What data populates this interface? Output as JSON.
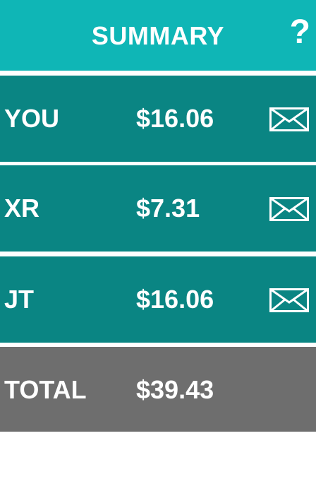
{
  "header": {
    "title": "SUMMARY",
    "help_label": "?"
  },
  "rows": [
    {
      "name": "YOU",
      "amount": "$16.06",
      "icon": "envelope-icon"
    },
    {
      "name": "XR",
      "amount": "$7.31",
      "icon": "envelope-icon"
    },
    {
      "name": "JT",
      "amount": "$16.06",
      "icon": "envelope-icon"
    }
  ],
  "total": {
    "label": "TOTAL",
    "amount": "$39.43"
  },
  "colors": {
    "header_bg": "#0fb6b6",
    "row_bg": "#0a8583",
    "total_bg": "#6e6e6e",
    "text": "#ffffff"
  }
}
